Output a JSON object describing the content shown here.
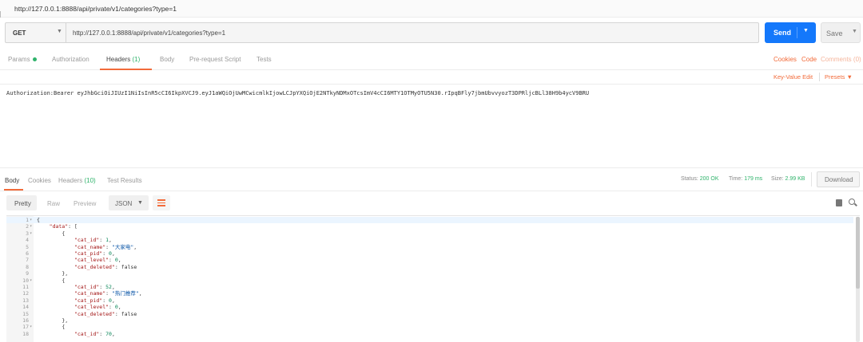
{
  "window": {
    "title": "http://127.0.0.1:8888/api/private/v1/categories?type=1"
  },
  "request": {
    "method": "GET",
    "url": "http://127.0.0.1:8888/api/private/v1/categories?type=1",
    "send_label": "Send",
    "save_label": "Save"
  },
  "request_tabs": [
    {
      "label": "Params",
      "dot": true
    },
    {
      "label": "Authorization"
    },
    {
      "label": "Headers",
      "count": "(1)",
      "active": true
    },
    {
      "label": "Body"
    },
    {
      "label": "Pre-request Script"
    },
    {
      "label": "Tests"
    }
  ],
  "request_links": {
    "cookies": "Cookies",
    "code": "Code",
    "comments": "Comments (0)"
  },
  "headers_bar": {
    "kv_edit": "Key-Value Edit",
    "presets": "Presets"
  },
  "headers_text": "Authorization:Bearer eyJhbGciOiJIUzI1NiIsInR5cCI6IkpXVCJ9.eyJ1aWQiOjUwMCwicmlkIjowLCJpYXQiOjE2NTkyNDMxOTcsImV4cCI6MTY1OTMyOTU5N30.rIpqBFly7jbmUbvvyozT3DPRljcBLl38H9b4ycV9BRU",
  "response_tabs": [
    {
      "label": "Body",
      "active": true
    },
    {
      "label": "Cookies"
    },
    {
      "label": "Headers",
      "count": "(10)"
    },
    {
      "label": "Test Results"
    }
  ],
  "response_meta": {
    "status_label": "Status:",
    "status_value": "200 OK",
    "time_label": "Time:",
    "time_value": "179 ms",
    "size_label": "Size:",
    "size_value": "2.99 KB",
    "download_label": "Download"
  },
  "view_options": {
    "pretty": "Pretty",
    "raw": "Raw",
    "preview": "Preview",
    "format": "JSON"
  },
  "code_lines": [
    {
      "n": "1",
      "fold": true,
      "text": "{",
      "hl": true
    },
    {
      "n": "2",
      "fold": true,
      "indent": 1,
      "key": "\"data\"",
      "rest": ": ["
    },
    {
      "n": "3",
      "fold": true,
      "indent": 2,
      "text": "{"
    },
    {
      "n": "4",
      "indent": 3,
      "key": "\"cat_id\"",
      "num": "1",
      "tail": ","
    },
    {
      "n": "5",
      "indent": 3,
      "key": "\"cat_name\"",
      "str": "\"大家电\"",
      "tail": ","
    },
    {
      "n": "6",
      "indent": 3,
      "key": "\"cat_pid\"",
      "num": "0",
      "tail": ","
    },
    {
      "n": "7",
      "indent": 3,
      "key": "\"cat_level\"",
      "num": "0",
      "tail": ","
    },
    {
      "n": "8",
      "indent": 3,
      "key": "\"cat_deleted\"",
      "bool": "false"
    },
    {
      "n": "9",
      "indent": 2,
      "text": "},"
    },
    {
      "n": "10",
      "fold": true,
      "indent": 2,
      "text": "{"
    },
    {
      "n": "11",
      "indent": 3,
      "key": "\"cat_id\"",
      "num": "52",
      "tail": ","
    },
    {
      "n": "12",
      "indent": 3,
      "key": "\"cat_name\"",
      "str": "\"热门推荐\"",
      "tail": ","
    },
    {
      "n": "13",
      "indent": 3,
      "key": "\"cat_pid\"",
      "num": "0",
      "tail": ","
    },
    {
      "n": "14",
      "indent": 3,
      "key": "\"cat_level\"",
      "num": "0",
      "tail": ","
    },
    {
      "n": "15",
      "indent": 3,
      "key": "\"cat_deleted\"",
      "bool": "false"
    },
    {
      "n": "16",
      "indent": 2,
      "text": "},"
    },
    {
      "n": "17",
      "fold": true,
      "indent": 2,
      "text": "{"
    },
    {
      "n": "18",
      "indent": 3,
      "key": "\"cat_id\"",
      "num": "70",
      "tail": ","
    }
  ],
  "colors": {
    "accent": "#f26b3a",
    "send": "#1478fb",
    "success": "#2fb36b"
  }
}
